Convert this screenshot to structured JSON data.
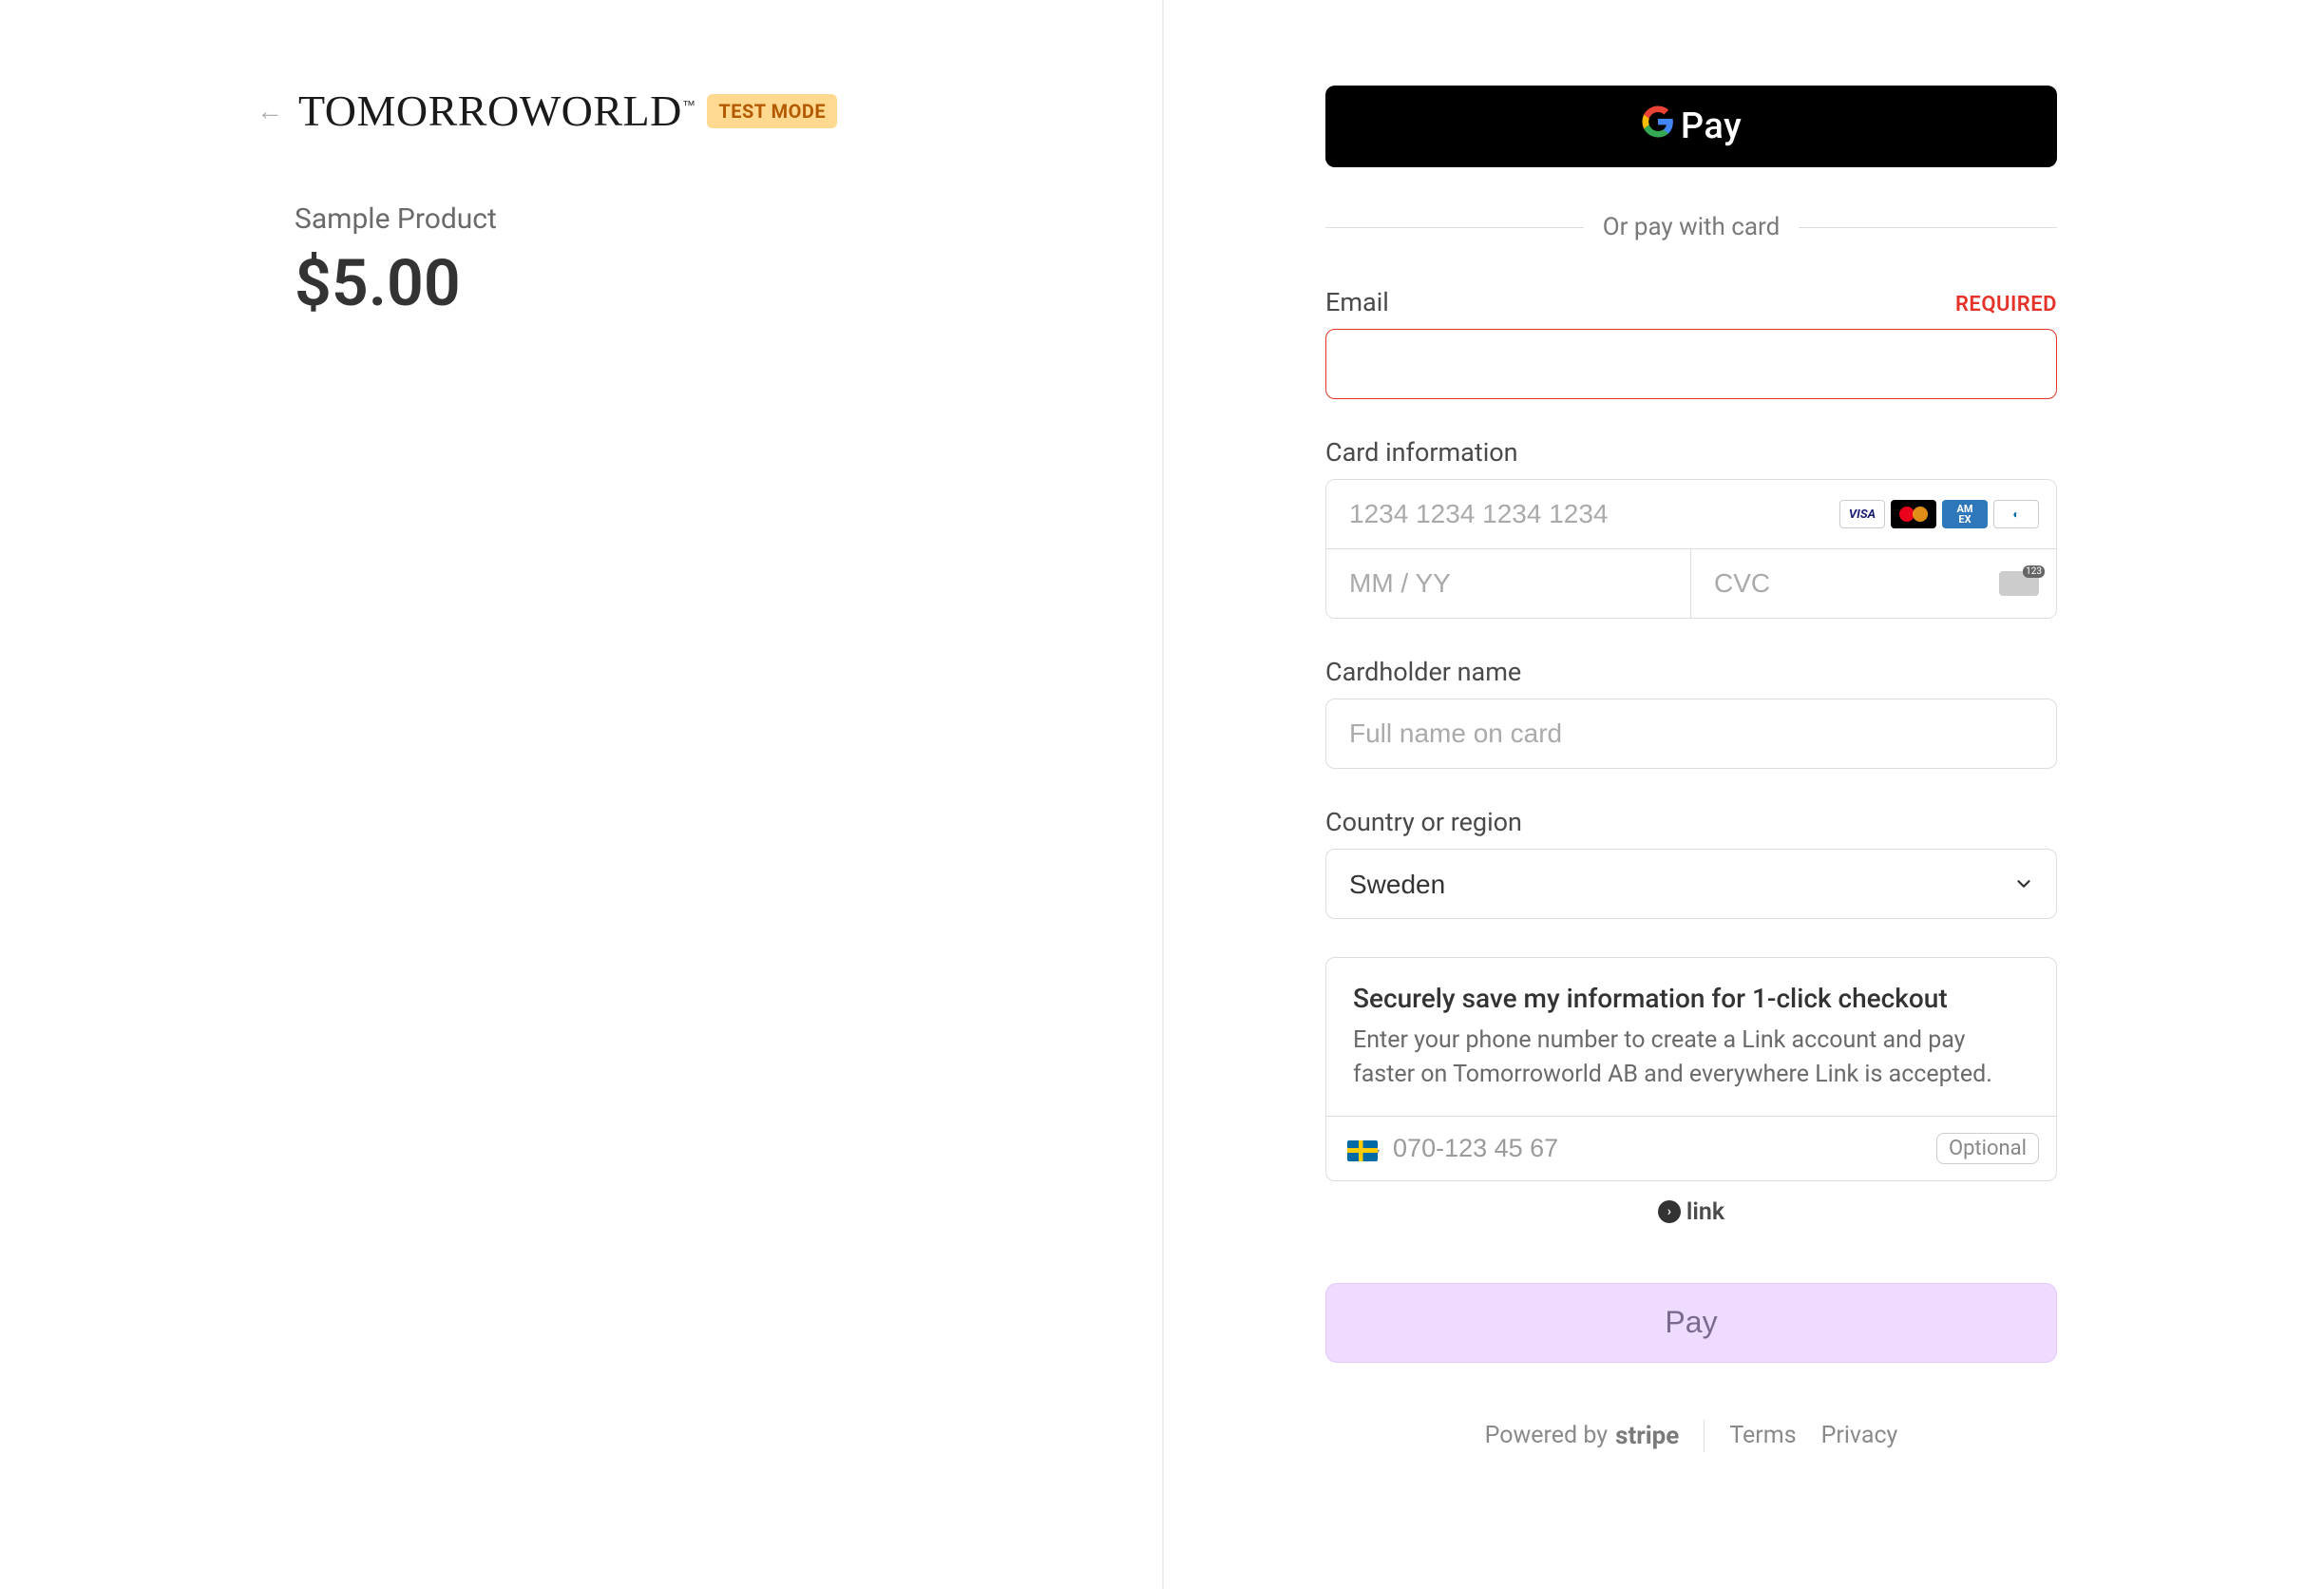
{
  "brand": {
    "name": "TOMORROWORLD",
    "trademark": "™",
    "badge": "TEST MODE"
  },
  "product": {
    "name": "Sample Product",
    "price": "$5.00"
  },
  "gpay": {
    "label": "Pay"
  },
  "divider": "Or pay with card",
  "email": {
    "label": "Email",
    "required_tag": "REQUIRED",
    "value": ""
  },
  "card": {
    "label": "Card information",
    "number_placeholder": "1234 1234 1234 1234",
    "exp_placeholder": "MM / YY",
    "cvc_placeholder": "CVC",
    "brands": {
      "visa": "VISA",
      "amex": "AM\nEX"
    }
  },
  "name": {
    "label": "Cardholder name",
    "placeholder": "Full name on card"
  },
  "country": {
    "label": "Country or region",
    "selected": "Sweden"
  },
  "link": {
    "title": "Securely save my information for 1-click checkout",
    "desc": "Enter your phone number to create a Link account and pay faster on Tomorroworld AB and everywhere Link is accepted.",
    "phone_placeholder": "070-123 45 67",
    "optional": "Optional",
    "brand": "link"
  },
  "pay_button": "Pay",
  "footer": {
    "powered": "Powered by",
    "stripe": "stripe",
    "terms": "Terms",
    "privacy": "Privacy"
  }
}
